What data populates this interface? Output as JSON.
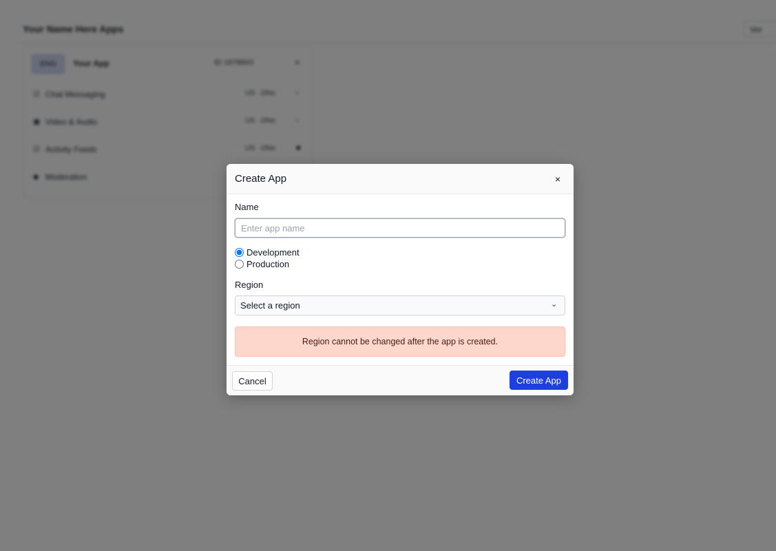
{
  "background": {
    "page_title": "Your Name Here Apps",
    "header_button": "Ver",
    "app_row": {
      "badge": "ENG",
      "name": "Your App",
      "app_id": "ID 1678603",
      "close_glyph": "×"
    },
    "items": [
      {
        "icon": "☑",
        "label": "Chat Messaging",
        "meta": "US · Ohio",
        "end": "›"
      },
      {
        "icon": "▣",
        "label": "Video & Audio",
        "meta": "US · Ohio",
        "end": "›"
      },
      {
        "icon": "☑",
        "label": "Activity Feeds",
        "meta": "US · Ohio",
        "end": "■"
      },
      {
        "icon": "◆",
        "label": "Moderation",
        "meta": "",
        "end": ""
      }
    ]
  },
  "modal": {
    "title": "Create App",
    "close_glyph": "×",
    "name_label": "Name",
    "name_placeholder": "Enter app name",
    "name_value": "",
    "environment_options": [
      {
        "label": "Development",
        "selected": true
      },
      {
        "label": "Production",
        "selected": false
      }
    ],
    "region_label": "Region",
    "region_value": "Select a region",
    "region_chevron": "⌄",
    "warning_text": "Region cannot be changed after the app is created.",
    "cancel_label": "Cancel",
    "create_label": "Create App"
  },
  "colors": {
    "overlay": "#808080",
    "primary": "#1d3fe0",
    "warning_bg": "#fed7cc",
    "warning_text": "#4b1c10"
  },
  "icons": {
    "close": "close-icon",
    "chevron": "chevron-down-icon"
  }
}
